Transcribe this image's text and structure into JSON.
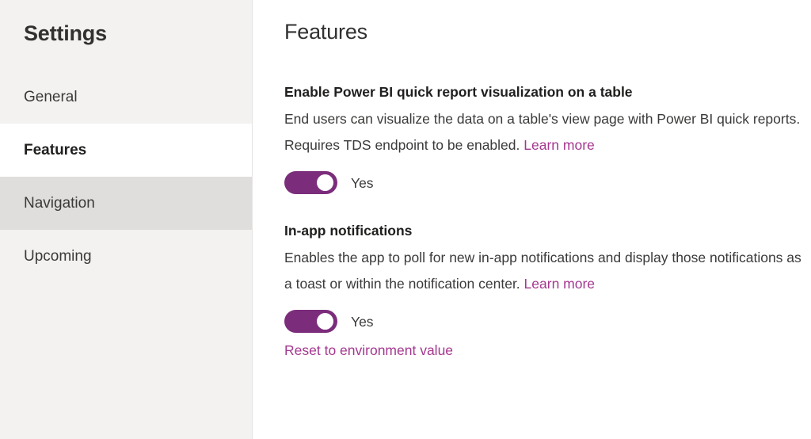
{
  "sidebar": {
    "title": "Settings",
    "items": [
      {
        "label": "General",
        "state": "default"
      },
      {
        "label": "Features",
        "state": "selected"
      },
      {
        "label": "Navigation",
        "state": "hovered"
      },
      {
        "label": "Upcoming",
        "state": "default"
      }
    ]
  },
  "main": {
    "title": "Features",
    "features": [
      {
        "name": "Enable Power BI quick report visualization on a table",
        "description": "End users can visualize the data on a table's view page with Power BI quick reports. Requires TDS endpoint to be enabled.",
        "learn_more_label": "Learn more",
        "toggle_state": "on",
        "toggle_label": "Yes",
        "reset_label": null
      },
      {
        "name": "In-app notifications",
        "description": "Enables the app to poll for new in-app notifications and display those notifications as a toast or within the notification center.",
        "learn_more_label": "Learn more",
        "toggle_state": "on",
        "toggle_label": "Yes",
        "reset_label": "Reset to environment value"
      }
    ]
  },
  "colors": {
    "accent_purple": "#7b2d7b",
    "link_purple": "#a4378f",
    "sidebar_bg": "#f3f2f1",
    "selected_bg": "#ffffff",
    "hover_bg": "#dfdedc",
    "text_primary": "#201f1e",
    "text_secondary": "#3b3a39"
  }
}
